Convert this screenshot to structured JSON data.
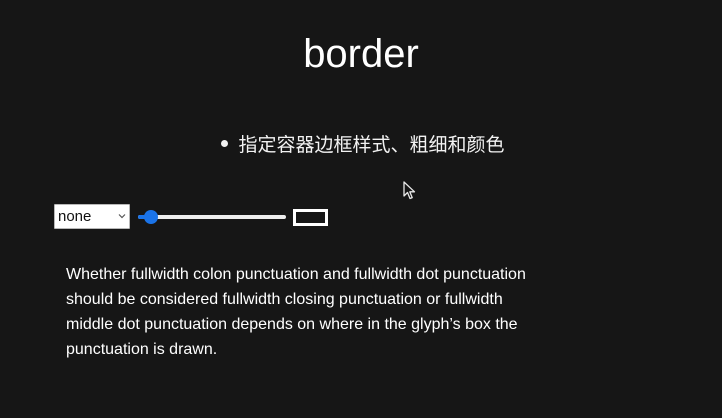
{
  "slide": {
    "title": "border",
    "bullet": "指定容器边框样式、粗细和颜色"
  },
  "controls": {
    "border_style_select": {
      "selected": "none"
    },
    "border_width_slider": {
      "value_fraction": 0.06
    }
  },
  "paragraph": {
    "lines": [
      "Whether fullwidth colon punctuation and fullwidth dot punctuation",
      "should be considered fullwidth closing punctuation or fullwidth",
      "middle dot punctuation depends on where in the glyph’s box the",
      "punctuation is drawn."
    ]
  },
  "colors": {
    "background": "#161616",
    "text": "#ffffff",
    "accent": "#1a73e8"
  },
  "icons": {
    "cursor": "mouse-pointer-icon",
    "select_arrow": "chevron-down-icon"
  }
}
